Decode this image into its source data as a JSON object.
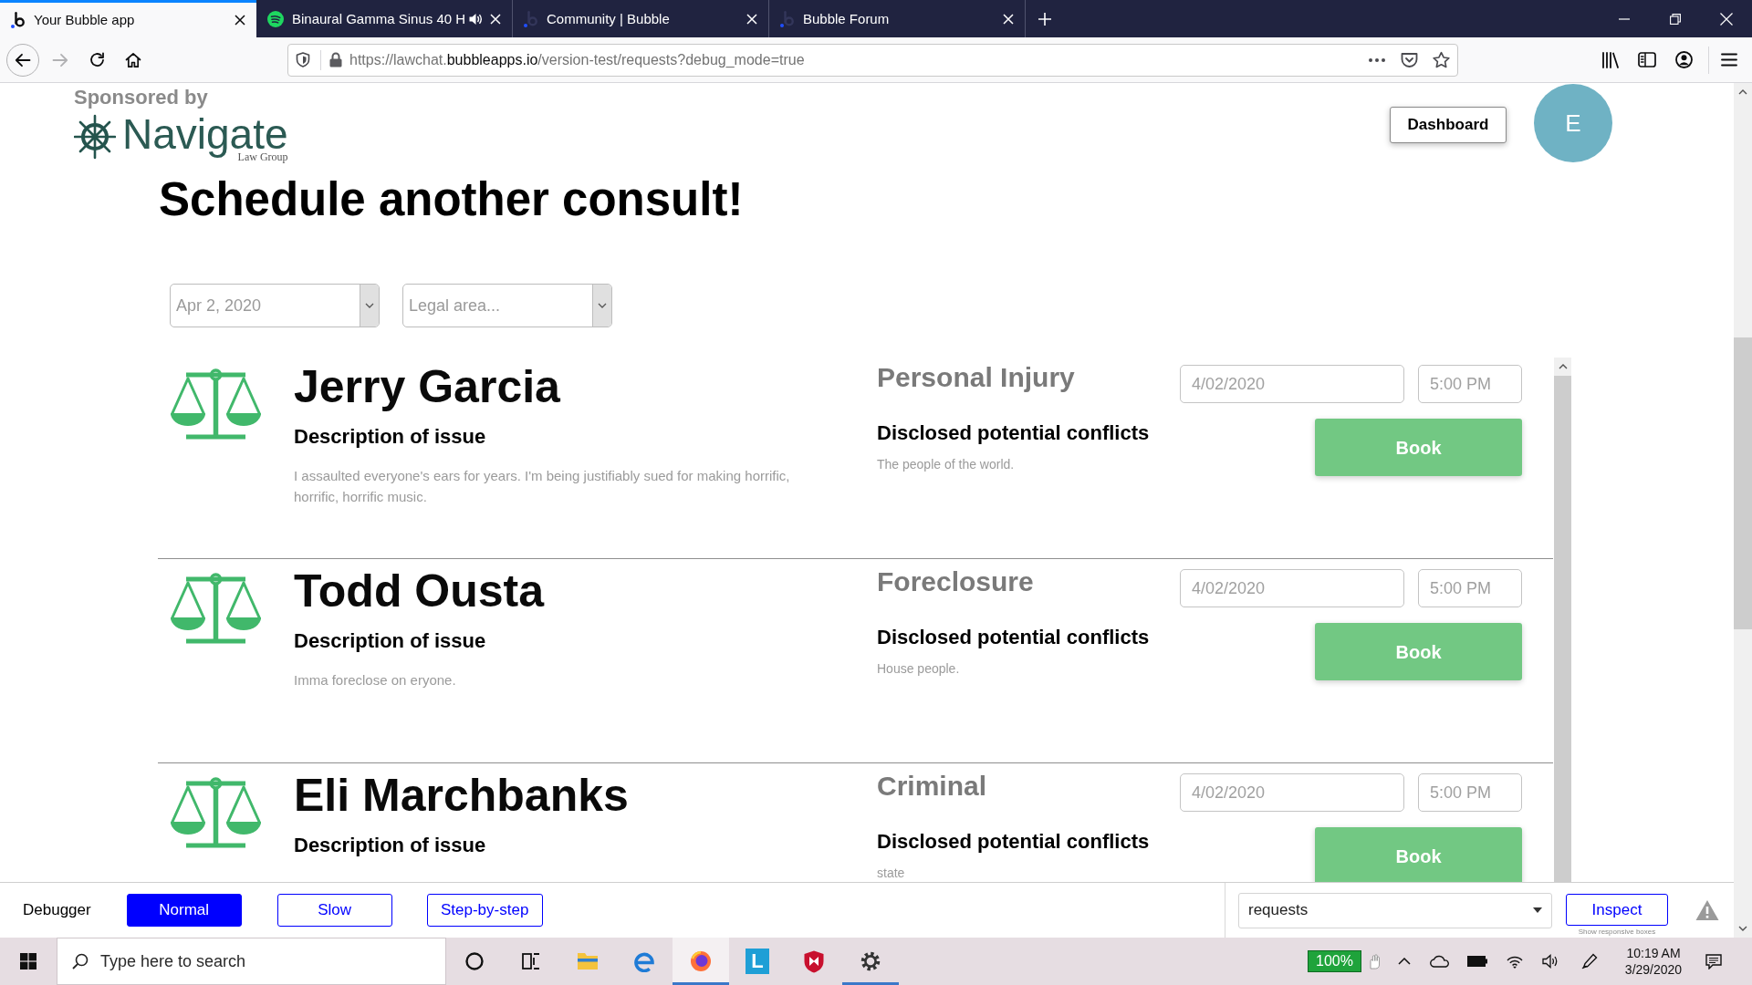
{
  "browser": {
    "tabs": [
      {
        "kind": "letter",
        "title": "Your Bubble app",
        "selected": true,
        "playing": false
      },
      {
        "kind": "waves",
        "title": "Binaural Gamma Sinus 40 H",
        "selected": false,
        "playing": true
      },
      {
        "kind": "letter",
        "title": "Community | Bubble",
        "selected": false,
        "playing": false
      },
      {
        "kind": "letter",
        "title": "Bubble Forum",
        "selected": false,
        "playing": false
      }
    ],
    "forward_enabled": false,
    "url": {
      "start": "https://lawchat.",
      "domain": "bubbleapps.io",
      "rest": "/version-test/requests?debug_mode=true"
    }
  },
  "page": {
    "sponsor_label": "Sponsored by",
    "logo": {
      "name": "Navigate",
      "subtitle": "Law Group"
    },
    "dashboard_button": "Dashboard",
    "avatar_initial": "E",
    "heading": "Schedule another consult!",
    "date_filter": {
      "value": "Apr 2, 2020"
    },
    "area_filter": {
      "placeholder": "Legal area..."
    },
    "requests": [
      {
        "name": "Jerry Garcia",
        "description_heading": "Description of issue",
        "description": "I assaulted everyone's ears for years. I'm being justifiably sued for making horrific, horrific, horrific music.",
        "legal_area": "Personal Injury",
        "conflicts_heading": "Disclosed potential conflicts",
        "conflicts": "The people of the world.",
        "date": "4/02/2020",
        "time": "5:00 PM",
        "book_button": "Book"
      },
      {
        "name": "Todd Ousta",
        "description_heading": "Description of issue",
        "description": "Imma foreclose on eryone.",
        "legal_area": "Foreclosure",
        "conflicts_heading": "Disclosed potential conflicts",
        "conflicts": "House people.",
        "date": "4/02/2020",
        "time": "5:00 PM",
        "book_button": "Book"
      },
      {
        "name": "Eli Marchbanks",
        "description_heading": "Description of issue",
        "legal_area": "Criminal",
        "conflicts_heading": "Disclosed potential conflicts",
        "conflicts": "state",
        "date": "4/02/2020",
        "time": "5:00 PM",
        "book_button": "Book"
      }
    ]
  },
  "debugger": {
    "label": "Debugger",
    "modes": [
      {
        "label": "Normal",
        "selected": true
      },
      {
        "label": "Slow",
        "selected": false
      },
      {
        "label": "Step-by-step",
        "selected": false
      }
    ],
    "element_select": {
      "value": "requests"
    },
    "inspect_button": "Inspect",
    "inspect_note": "Show responsive boxes"
  },
  "taskbar": {
    "search_placeholder": "Type here to search",
    "apps": [
      {
        "kind": "ring",
        "selected": false,
        "running": false
      },
      {
        "kind": "panes",
        "selected": false,
        "running": false
      },
      {
        "kind": "folder",
        "selected": false,
        "running": false
      },
      {
        "kind": "e-logo",
        "selected": false,
        "running": false
      },
      {
        "kind": "globe",
        "selected": true,
        "running": true
      },
      {
        "kind": "tile",
        "label": "L",
        "selected": false,
        "running": false
      },
      {
        "kind": "shield",
        "selected": false,
        "running": false
      },
      {
        "kind": "gear",
        "selected": false,
        "running": true
      }
    ],
    "battery_label": "100%",
    "time": "10:19 AM",
    "date": "3/29/2020"
  }
}
